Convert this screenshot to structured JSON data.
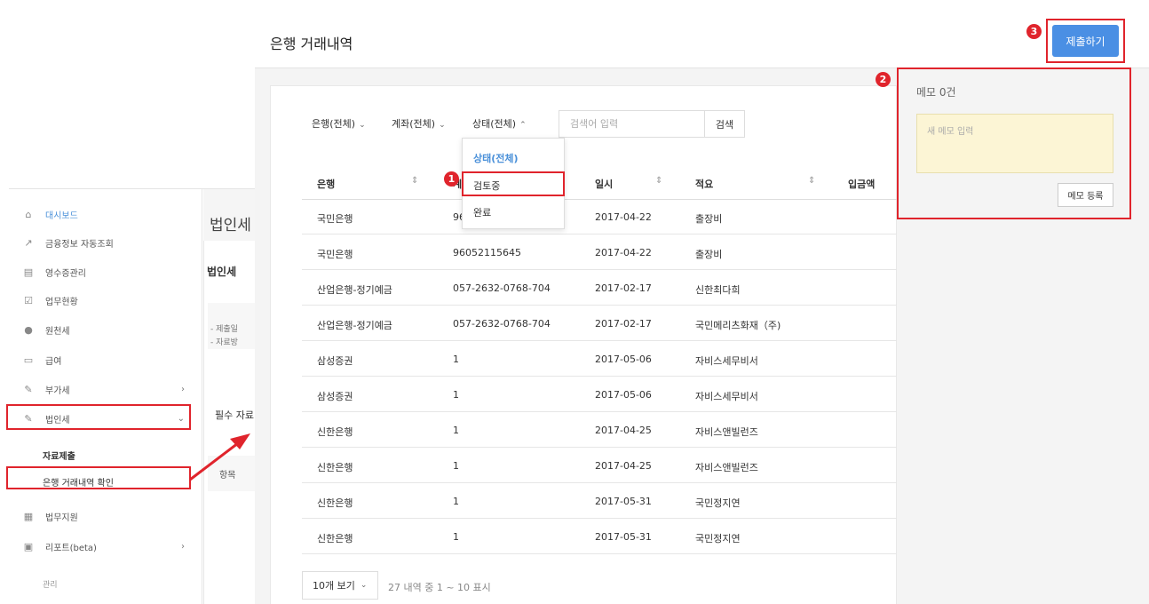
{
  "page_title": "은행 거래내역",
  "submit_label": "제출하기",
  "badges": [
    "1",
    "2",
    "3"
  ],
  "filters": {
    "bank": "은행(전체)",
    "account": "계좌(전체)",
    "status": "상태(전체)",
    "search_placeholder": "검색어 입력",
    "search_button": "검색"
  },
  "status_dropdown": [
    "상태(전체)",
    "검토중",
    "완료"
  ],
  "table": {
    "columns": [
      "은행",
      "계좌",
      "일시",
      "적요",
      "입금액"
    ],
    "rows": [
      [
        "국민은행",
        "96052115645",
        "2017-04-22",
        "출장비"
      ],
      [
        "국민은행",
        "96052115645",
        "2017-04-22",
        "출장비"
      ],
      [
        "산업은행-정기예금",
        "057-2632-0768-704",
        "2017-02-17",
        "신한최다희"
      ],
      [
        "산업은행-정기예금",
        "057-2632-0768-704",
        "2017-02-17",
        "국민메리츠화재（주)"
      ],
      [
        "삼성증권",
        "1",
        "2017-05-06",
        "자비스세무비서"
      ],
      [
        "삼성증권",
        "1",
        "2017-05-06",
        "자비스세무비서"
      ],
      [
        "신한은행",
        "1",
        "2017-04-25",
        "자비스앤빌런즈"
      ],
      [
        "신한은행",
        "1",
        "2017-04-25",
        "자비스앤빌런즈"
      ],
      [
        "신한은행",
        "1",
        "2017-05-31",
        "국민정지연"
      ],
      [
        "신한은행",
        "1",
        "2017-05-31",
        "국민정지연"
      ]
    ]
  },
  "pagination": {
    "page_size": "10개 보기",
    "info": "27 내역 중 1 ~ 10 표시"
  },
  "memo": {
    "title": "메모 0건",
    "placeholder": "새 메모 입력",
    "button": "메모 등록"
  },
  "sidebar": {
    "items": [
      {
        "label": "대시보드",
        "icon": "home-icon"
      },
      {
        "label": "금융정보 자동조회",
        "icon": "chart-icon"
      },
      {
        "label": "영수증관리",
        "icon": "receipt-icon"
      },
      {
        "label": "업무현황",
        "icon": "clipboard-icon"
      },
      {
        "label": "원천세",
        "icon": "coin-icon"
      },
      {
        "label": "급여",
        "icon": "card-icon"
      },
      {
        "label": "부가세",
        "icon": "pencil-icon"
      },
      {
        "label": "법인세",
        "icon": "pencil-icon"
      }
    ],
    "sub_items": [
      "자료제출",
      "은행 거래내역 확인"
    ],
    "items_after": [
      {
        "label": "법무지원",
        "icon": "document-icon"
      },
      {
        "label": "리포트(beta)",
        "icon": "report-icon"
      }
    ],
    "section": "관리"
  },
  "background_page": {
    "title": "법인세",
    "card_title": "법인세",
    "info_lines": [
      "- 제출일",
      "- 자료방"
    ],
    "required_label": "필수 자료",
    "table_header": "항목"
  },
  "colors": {
    "accent": "#4a8fe4",
    "highlight": "#e0242c",
    "memo_bg": "#fcf5d5"
  }
}
